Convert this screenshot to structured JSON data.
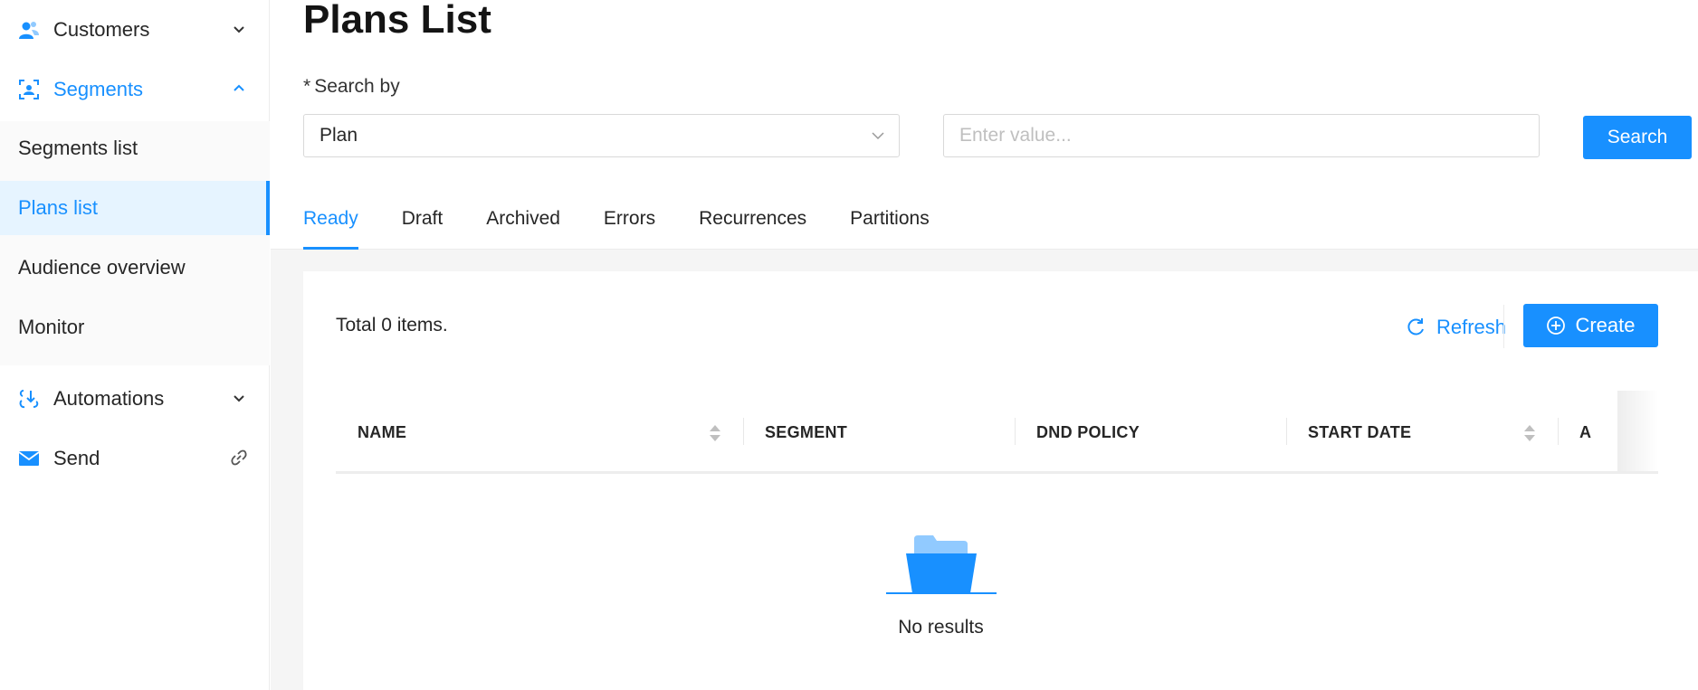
{
  "sidebar": {
    "groups": [
      {
        "label": "Customers",
        "icon": "customers-icon",
        "state": "collapsed"
      },
      {
        "label": "Segments",
        "icon": "segments-icon",
        "state": "expanded"
      },
      {
        "label": "Automations",
        "icon": "automations-icon",
        "state": "collapsed"
      },
      {
        "label": "Send",
        "icon": "send-icon",
        "trailing_icon": "link-icon"
      }
    ],
    "segments_items": [
      {
        "label": "Segments list"
      },
      {
        "label": "Plans list",
        "active": true
      },
      {
        "label": "Audience overview"
      },
      {
        "label": "Monitor"
      }
    ]
  },
  "header": {
    "title": "Plans List",
    "search_label_required": "*",
    "search_label": "Search by",
    "search_by_value": "Plan",
    "value_placeholder": "Enter value...",
    "search_button": "Search"
  },
  "tabs": [
    {
      "label": "Ready",
      "active": true
    },
    {
      "label": "Draft"
    },
    {
      "label": "Archived"
    },
    {
      "label": "Errors"
    },
    {
      "label": "Recurrences"
    },
    {
      "label": "Partitions"
    }
  ],
  "card": {
    "total_text": "Total 0 items.",
    "refresh_label": "Refresh",
    "create_label": "Create"
  },
  "table": {
    "columns": [
      {
        "label": "NAME",
        "sortable": true
      },
      {
        "label": "SEGMENT",
        "sortable": false
      },
      {
        "label": "DND POLICY",
        "sortable": false
      },
      {
        "label": "START DATE",
        "sortable": true
      },
      {
        "label": "A",
        "sortable": false
      }
    ],
    "empty_text": "No results"
  },
  "colors": {
    "accent": "#1890ff",
    "active_bg": "#e6f4ff",
    "text": "#262626"
  }
}
